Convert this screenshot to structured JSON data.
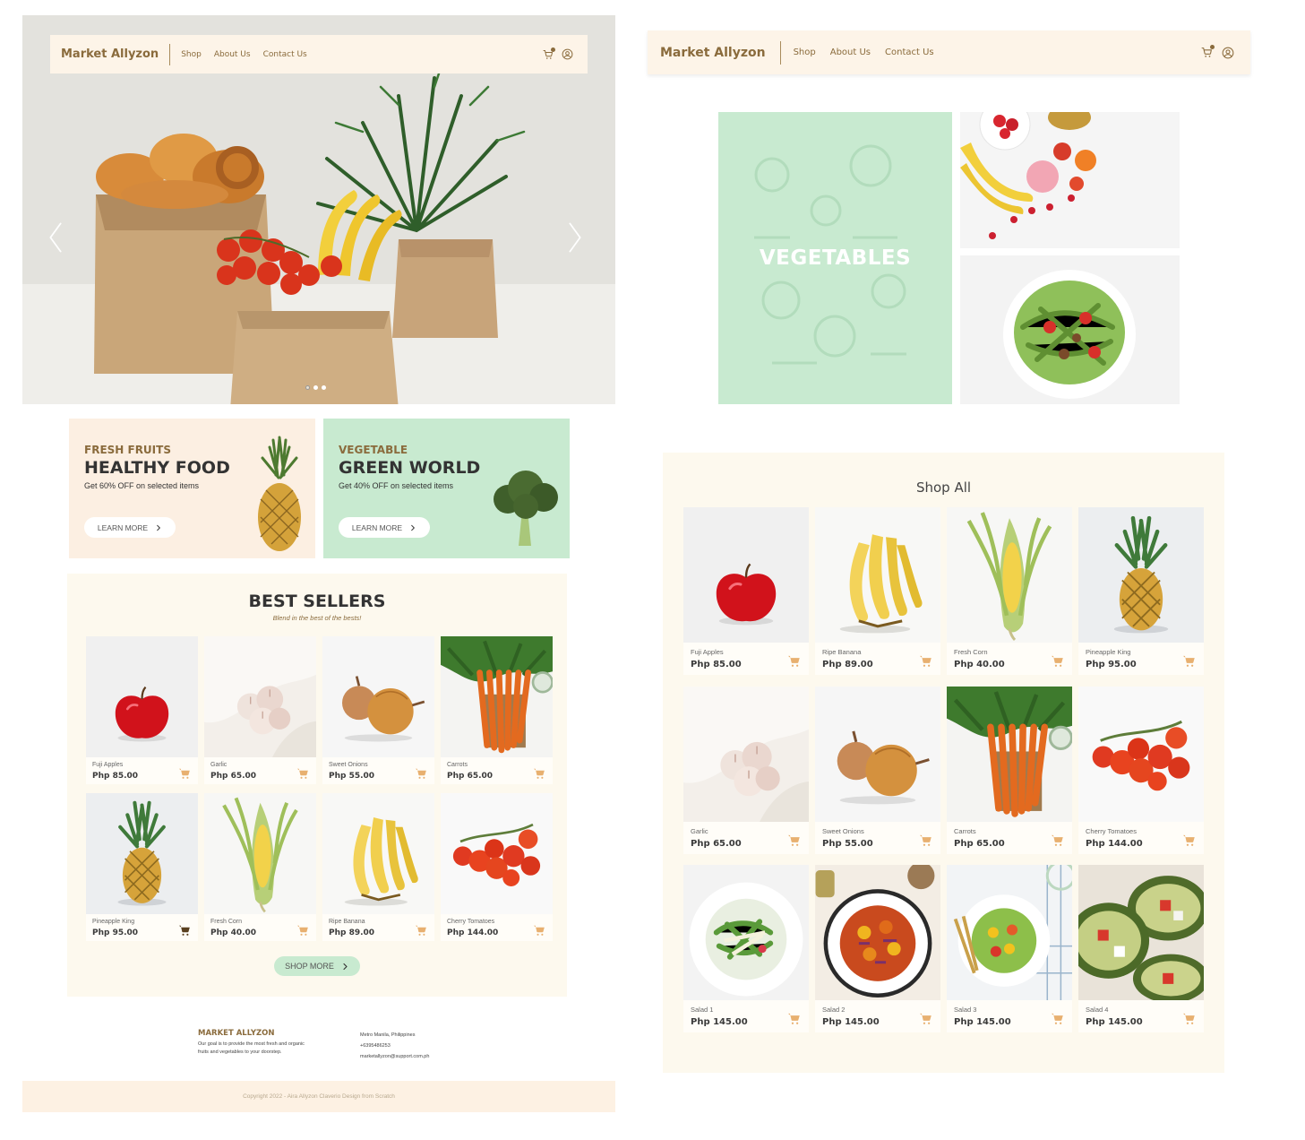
{
  "brand": "Market Allyzon",
  "nav": {
    "links": [
      "Shop",
      "About Us",
      "Contact Us"
    ]
  },
  "icons": {
    "cart": "cart-icon",
    "account": "user-circle-icon",
    "prev": "chevron-left-icon",
    "next": "chevron-right-icon"
  },
  "colors": {
    "accent_brown": "#8a6b3c",
    "cream": "#fdf4e8",
    "mint": "#c8ead0",
    "panel": "#fdf9ee",
    "cart_orange": "#e8b070"
  },
  "hero": {
    "slide_count": 3
  },
  "promos": [
    {
      "kicker": "FRESH FRUITS",
      "headline": "HEALTHY FOOD",
      "sub": "Get 60% OFF on selected items",
      "button": "LEARN MORE"
    },
    {
      "kicker": "VEGETABLE",
      "headline": "GREEN WORLD",
      "sub": "Get 40% OFF on selected items",
      "button": "LEARN MORE"
    }
  ],
  "best_sellers": {
    "title": "BEST SELLERS",
    "subtitle": "Blend in the best of the bests!",
    "items": [
      {
        "name": "Fuji Apples",
        "price": "Php 85.00"
      },
      {
        "name": "Garlic",
        "price": "Php 65.00"
      },
      {
        "name": "Sweet Onions",
        "price": "Php 55.00"
      },
      {
        "name": "Carrots",
        "price": "Php 65.00"
      },
      {
        "name": "Pineapple King",
        "price": "Php 95.00"
      },
      {
        "name": "Fresh Corn",
        "price": "Php 40.00"
      },
      {
        "name": "Ripe Banana",
        "price": "Php 89.00"
      },
      {
        "name": "Cherry Tomatoes",
        "price": "Php 144.00"
      }
    ],
    "button": "SHOP MORE"
  },
  "footer": {
    "brand": "MARKET ALLYZON",
    "about": "Our goal is to provide the most fresh and organic fruits and vegetables to your doorstep.",
    "address": "Metro Manila, Philippines",
    "phone": "+6395486253",
    "email": "marketallyzon@support.com.ph",
    "copyright": "Copyright 2022 - Aira Allyzon Claverio Design from Scratch"
  },
  "category": {
    "label": "VEGETABLES"
  },
  "shop_all": {
    "title": "Shop All",
    "items": [
      {
        "name": "Fuji Apples",
        "price": "Php 85.00"
      },
      {
        "name": "Ripe Banana",
        "price": "Php 89.00"
      },
      {
        "name": "Fresh Corn",
        "price": "Php 40.00"
      },
      {
        "name": "Pineapple King",
        "price": "Php 95.00"
      },
      {
        "name": "Garlic",
        "price": "Php 65.00"
      },
      {
        "name": "Sweet Onions",
        "price": "Php 55.00"
      },
      {
        "name": "Carrots",
        "price": "Php 65.00"
      },
      {
        "name": "Cherry Tomatoes",
        "price": "Php 144.00"
      },
      {
        "name": "Salad 1",
        "price": "Php 145.00"
      },
      {
        "name": "Salad 2",
        "price": "Php 145.00"
      },
      {
        "name": "Salad 3",
        "price": "Php 145.00"
      },
      {
        "name": "Salad 4",
        "price": "Php 145.00"
      }
    ]
  }
}
